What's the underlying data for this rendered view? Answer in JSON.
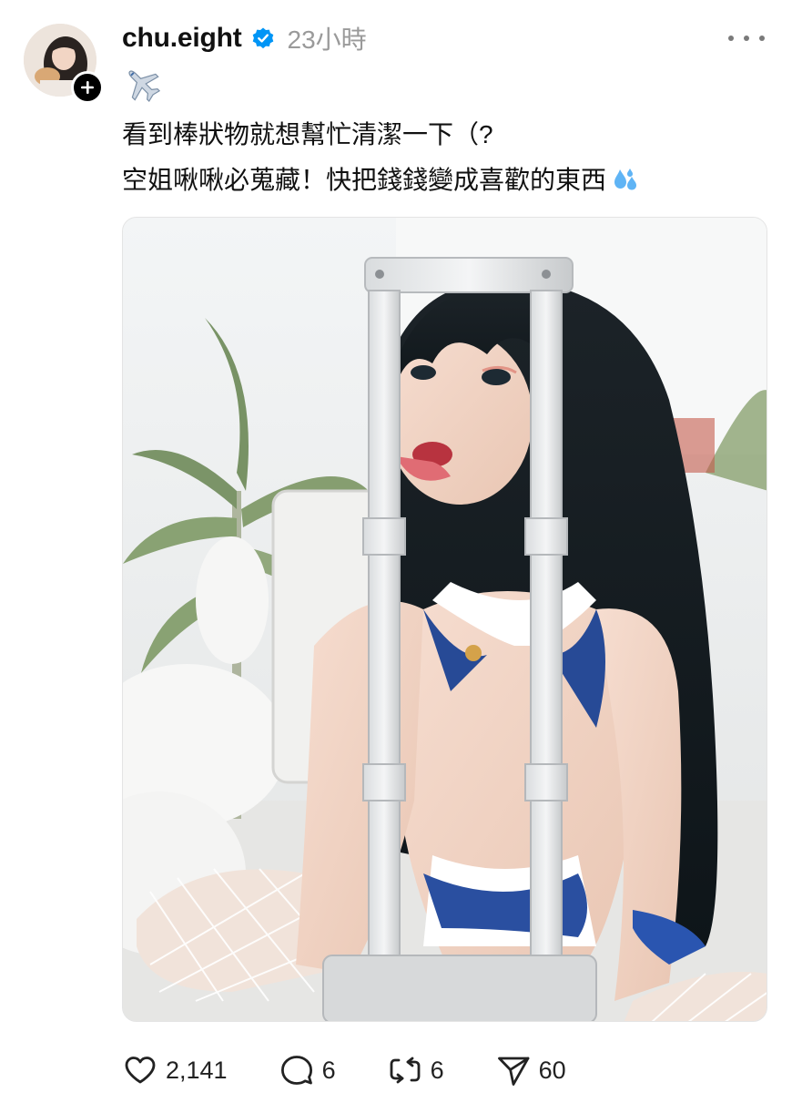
{
  "post": {
    "author": {
      "username": "chu.eight",
      "verified": true,
      "avatar_alt": "profile photo"
    },
    "timestamp": "23小時",
    "caption": {
      "line0_emoji": "✈️",
      "line1": "看到棒狀物就想幫忙清潔一下（?",
      "line2": "空姐啾啾必蒐藏！快把錢錢變成喜歡的東西",
      "line2_emoji": "💦"
    },
    "stats": {
      "likes": "2,141",
      "replies": "6",
      "reposts": "6",
      "shares": "60"
    }
  },
  "icons": {
    "more": "more-options-icon",
    "follow": "plus-icon",
    "verified": "verified-badge-icon",
    "like": "heart-icon",
    "reply": "comment-bubble-icon",
    "repost": "repost-icon",
    "share": "send-icon"
  },
  "colors": {
    "verified_blue": "#0095f6",
    "muted_text": "#9a9a9a",
    "text": "#111111"
  }
}
